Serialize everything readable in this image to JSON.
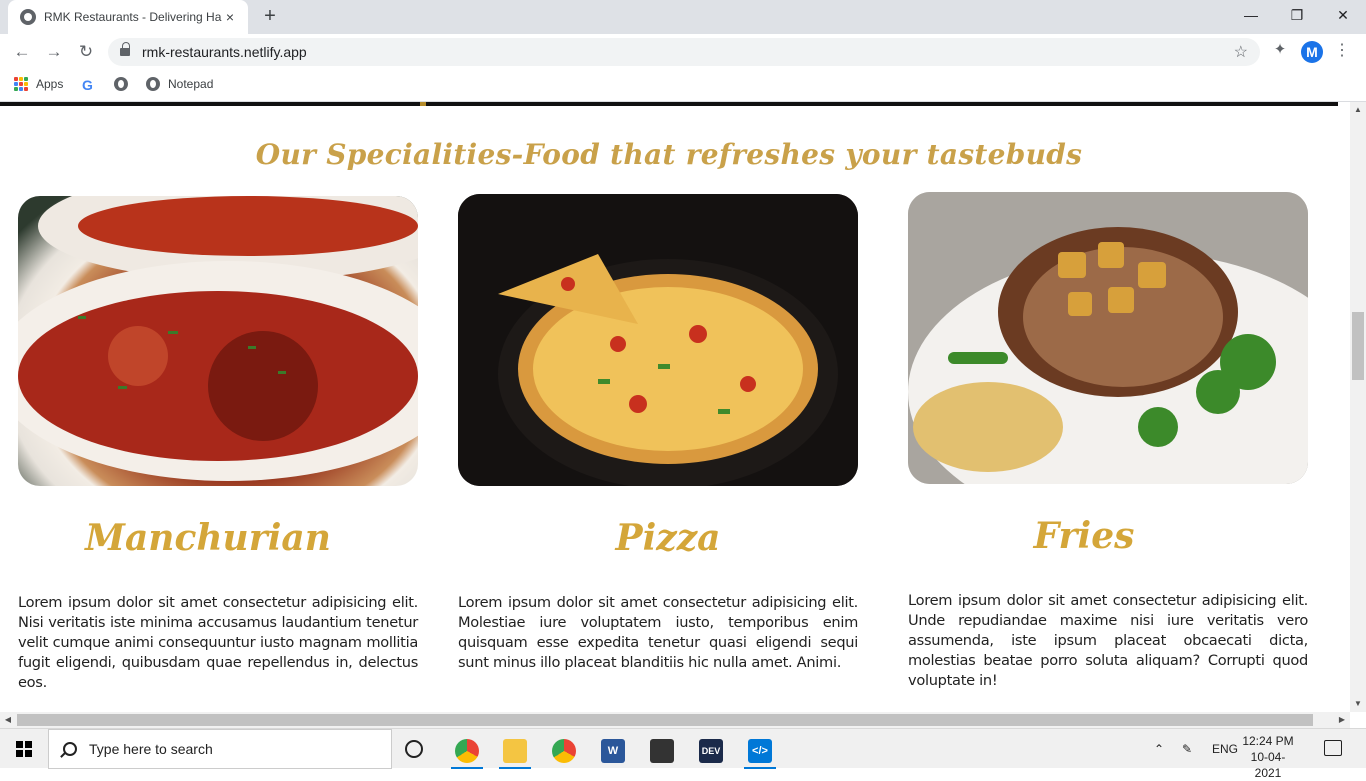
{
  "browser": {
    "tab_title": "RMK Restaurants - Delivering Ha",
    "tab_close": "×",
    "new_tab": "+",
    "url": "rmk-restaurants.netlify.app",
    "profile_initial": "M",
    "bookmarks": [
      {
        "label": "Apps",
        "icon": "apps-grid-icon"
      },
      {
        "label": "",
        "icon": "google-icon"
      },
      {
        "label": "",
        "icon": "globe-icon"
      },
      {
        "label": "Notepad",
        "icon": "globe-icon"
      }
    ],
    "window_controls": {
      "minimize": "—",
      "restore": "❐",
      "close": "✕"
    }
  },
  "page": {
    "section_title": "Our Specialities-Food that refreshes your tastebuds",
    "cards": [
      {
        "title": "Manchurian",
        "image": "spaghetti-meatballs",
        "text": "Lorem ipsum dolor sit amet consectetur adipisicing elit. Nisi veritatis iste minima accusamus laudantium tenetur velit cumque animi consequuntur iusto magnam mollitia fugit eligendi, quibusdam quae repellendus in, delectus eos."
      },
      {
        "title": "Pizza",
        "image": "pizza-slice",
        "text": "Lorem ipsum dolor sit amet consectetur adipisicing elit. Molestiae iure voluptatem iusto, temporibus enim quisquam esse expedita tenetur quasi eligendi sequi sunt minus illo placeat blanditiis hic nulla amet. Animi."
      },
      {
        "title": "Fries",
        "image": "grilled-steak",
        "text": "Lorem ipsum dolor sit amet consectetur adipisicing elit. Unde repudiandae maxime nisi iure veritatis vero assumenda, iste ipsum placeat obcaecati dicta, molestias beatae porro soluta aliquam? Corrupti quod voluptate in!"
      }
    ],
    "colors": {
      "accent_gold": "#c9a14a",
      "title_gold": "#d4a639"
    }
  },
  "taskbar": {
    "search_placeholder": "Type here to search",
    "language": "ENG",
    "time": "12:24 PM",
    "date": "10-04-2021",
    "apps": [
      "chrome-profile",
      "file-explorer",
      "chrome",
      "word",
      "store",
      "dev",
      "vscode"
    ]
  }
}
